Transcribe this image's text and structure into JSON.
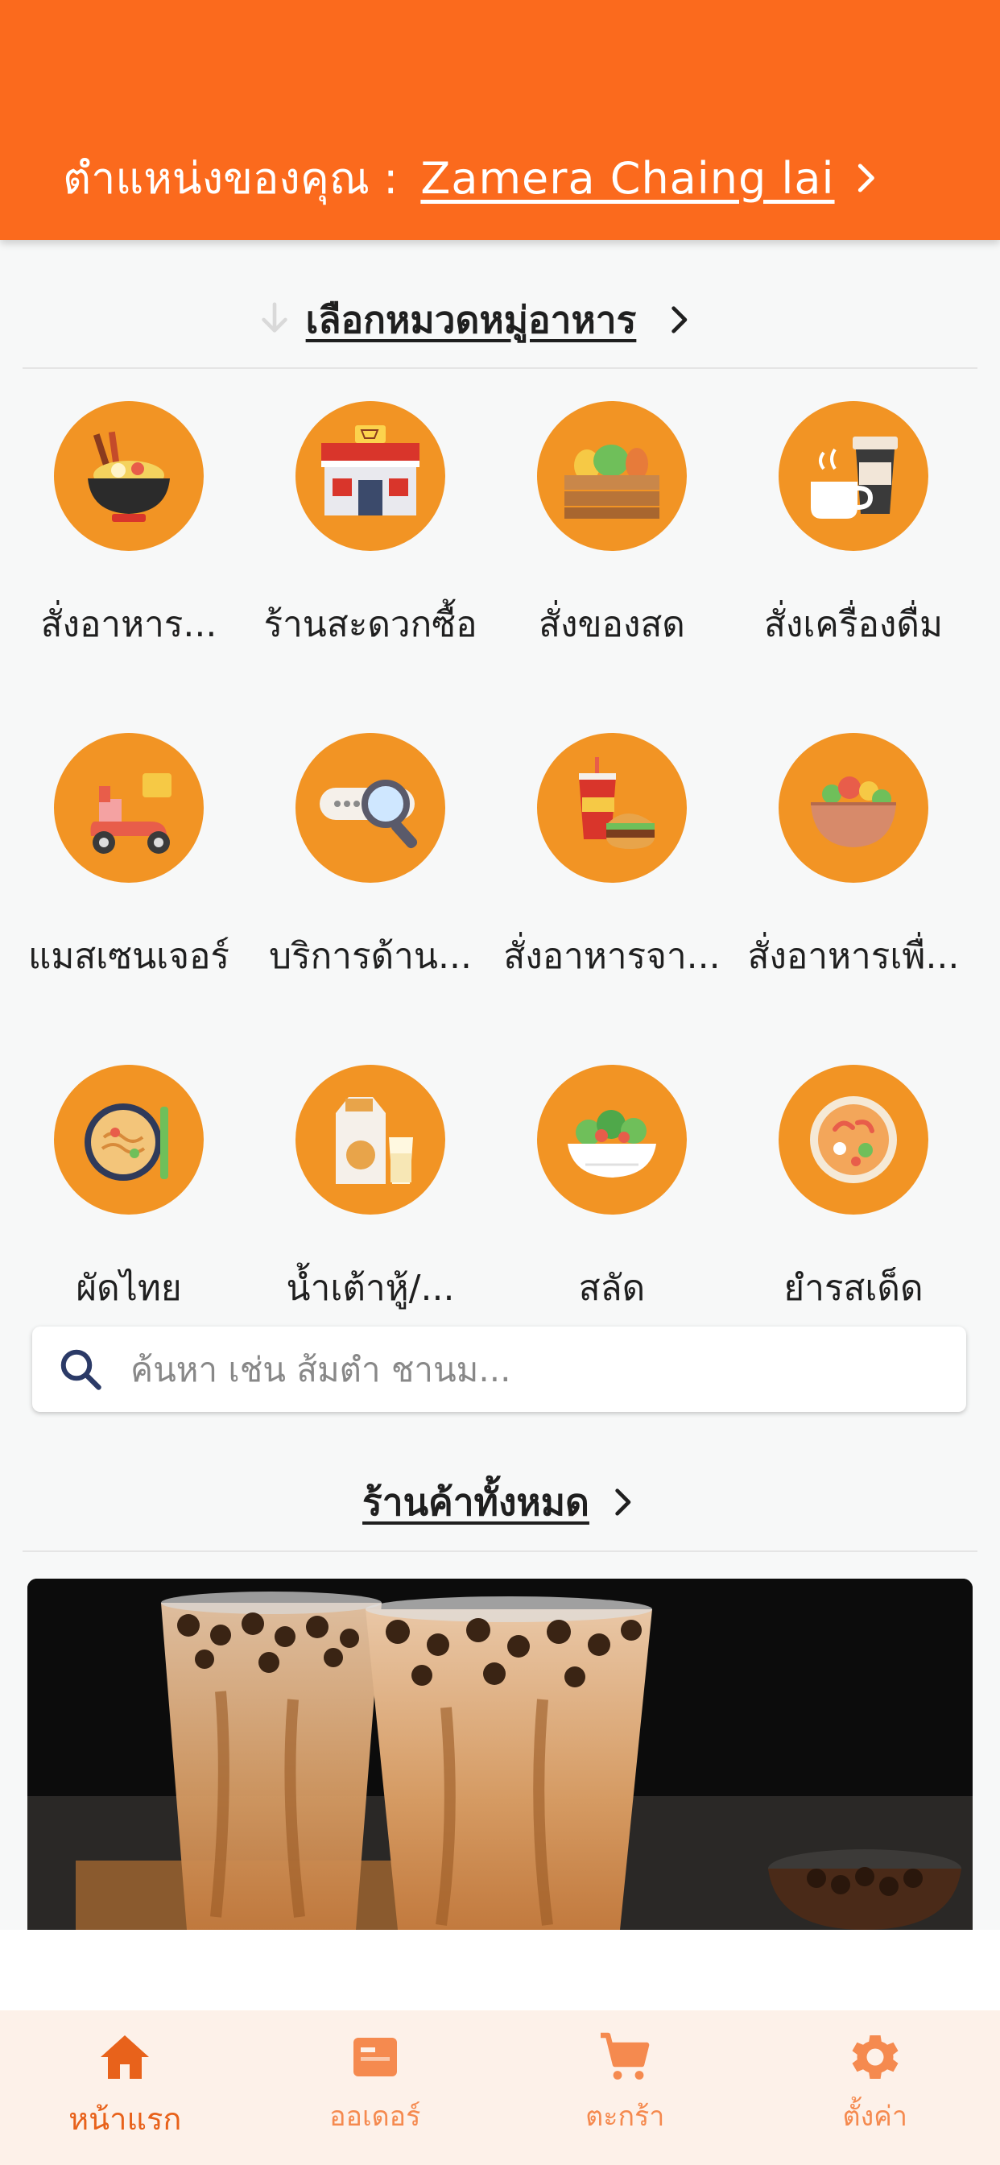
{
  "header": {
    "location_label": "ตำแหน่งของคุณ :",
    "location_value": "Zamera Chaing lai",
    "chevron_icon": "chevron-right-icon"
  },
  "categories_section": {
    "title": "เลือกหมวดหมู่อาหาร",
    "items": [
      {
        "label": "สั่งอาหาร...",
        "icon": "noodle-bowl-icon"
      },
      {
        "label": "ร้านสะดวกซื้อ",
        "icon": "convenience-store-icon"
      },
      {
        "label": "สั่งของสด",
        "icon": "fresh-produce-crate-icon"
      },
      {
        "label": "สั่งเครื่องดื่ม",
        "icon": "coffee-drinks-icon"
      },
      {
        "label": "แมสเซนเจอร์",
        "icon": "delivery-scooter-icon"
      },
      {
        "label": "บริการด้าน...",
        "icon": "search-service-icon"
      },
      {
        "label": "สั่งอาหารจา...",
        "icon": "fast-food-icon"
      },
      {
        "label": "สั่งอาหารเพื่...",
        "icon": "healthy-bowl-icon"
      },
      {
        "label": "ผัดไทย",
        "icon": "pad-thai-icon"
      },
      {
        "label": "น้ำเต้าหู้/...",
        "icon": "soy-milk-icon"
      },
      {
        "label": "สลัด",
        "icon": "salad-bowl-icon"
      },
      {
        "label": "ยำรสเด็ด",
        "icon": "spicy-salad-icon"
      }
    ]
  },
  "search": {
    "placeholder": "ค้นหา เช่น ส้มตำ ชานม..."
  },
  "shops_section": {
    "title": "ร้านค้าทั้งหมด"
  },
  "colors": {
    "primary": "#fb6a1d",
    "category_circle": "#f29424",
    "nav_background": "#fdf1e9"
  },
  "bottom_nav": {
    "items": [
      {
        "label": "หน้าแรก",
        "icon": "home-icon",
        "active": true
      },
      {
        "label": "ออเดอร์",
        "icon": "receipt-icon",
        "active": false
      },
      {
        "label": "ตะกร้า",
        "icon": "cart-icon",
        "active": false
      },
      {
        "label": "ตั้งค่า",
        "icon": "gear-icon",
        "active": false
      }
    ]
  }
}
